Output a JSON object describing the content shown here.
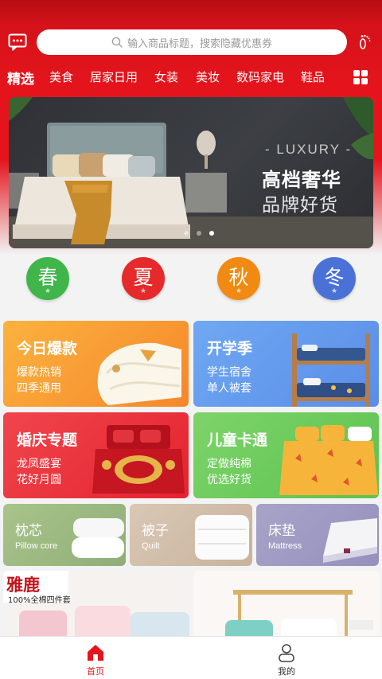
{
  "search": {
    "placeholder": "输入商品标题，搜索隐藏优惠券"
  },
  "categories": [
    "精选",
    "美食",
    "居家日用",
    "女装",
    "美妆",
    "数码家电",
    "鞋品"
  ],
  "banner": {
    "line1": "- LUXURY -",
    "line2": "高档奢华",
    "line3": "品牌好货",
    "slide_count": 3,
    "active_slide": 3
  },
  "seasons": [
    {
      "label": "春",
      "color": "#3fb54a"
    },
    {
      "label": "夏",
      "color": "#e6292a"
    },
    {
      "label": "秋",
      "color": "#f18a13"
    },
    {
      "label": "冬",
      "color": "#4a72d6"
    }
  ],
  "promos": [
    {
      "title": "今日爆款",
      "line1": "爆款热销",
      "line2": "四季通用"
    },
    {
      "title": "开学季",
      "line1": "学生宿舍",
      "line2": "单人被套"
    },
    {
      "title": "婚庆专题",
      "line1": "龙凤盛宴",
      "line2": "花好月圆"
    },
    {
      "title": "儿童卡通",
      "line1": "定做纯棉",
      "line2": "优选好货"
    }
  ],
  "small_cards": [
    {
      "title": "枕芯",
      "sub": "Pillow core"
    },
    {
      "title": "被子",
      "sub": "Quilt"
    },
    {
      "title": "床垫",
      "sub": "Mattress"
    }
  ],
  "product_brand": {
    "logo": "雅鹿",
    "tagline": "100%全棉四件套"
  },
  "tabs": [
    {
      "label": "首页",
      "active": true
    },
    {
      "label": "我的",
      "active": false
    }
  ],
  "colors": {
    "brand_red": "#e5141c",
    "tab_active": "#e5141c"
  }
}
